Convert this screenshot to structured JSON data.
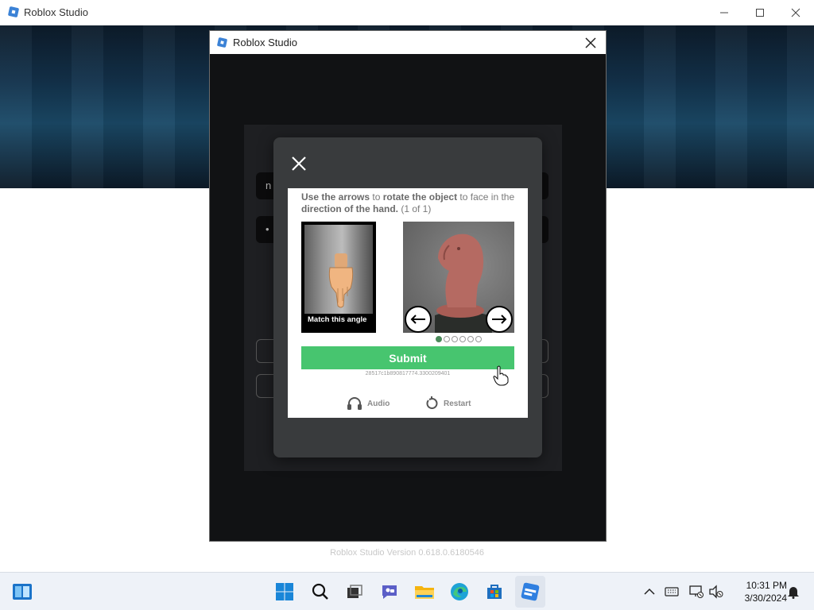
{
  "app": {
    "title": "Roblox Studio",
    "version": "Roblox Studio Version 0.618.0.6180546"
  },
  "dialog": {
    "title": "Roblox Studio",
    "fields": [
      "n",
      "•"
    ]
  },
  "captcha": {
    "instruction_part1": "Use the arrows",
    "instruction_part2": " to ",
    "instruction_part3": "rotate the object",
    "instruction_part4": " to face in the ",
    "instruction_part5": "direction of the hand.",
    "instruction_part6": " (1 of 1)",
    "reference_label": "Match this angle",
    "submit_label": "Submit",
    "session_id": "28517c1b890817774.3300209401",
    "audio_label": "Audio",
    "restart_label": "Restart",
    "page_count": 6,
    "current_page": 1,
    "colors": {
      "submit": "#47c56f",
      "modal": "#393b3d"
    }
  },
  "taskbar": {
    "time": "10:31 PM",
    "date": "3/30/2024",
    "icons": [
      "start-icon",
      "search-icon",
      "task-view-icon",
      "chat-icon",
      "file-explorer-icon",
      "edge-icon",
      "store-icon",
      "roblox-studio-icon"
    ]
  }
}
